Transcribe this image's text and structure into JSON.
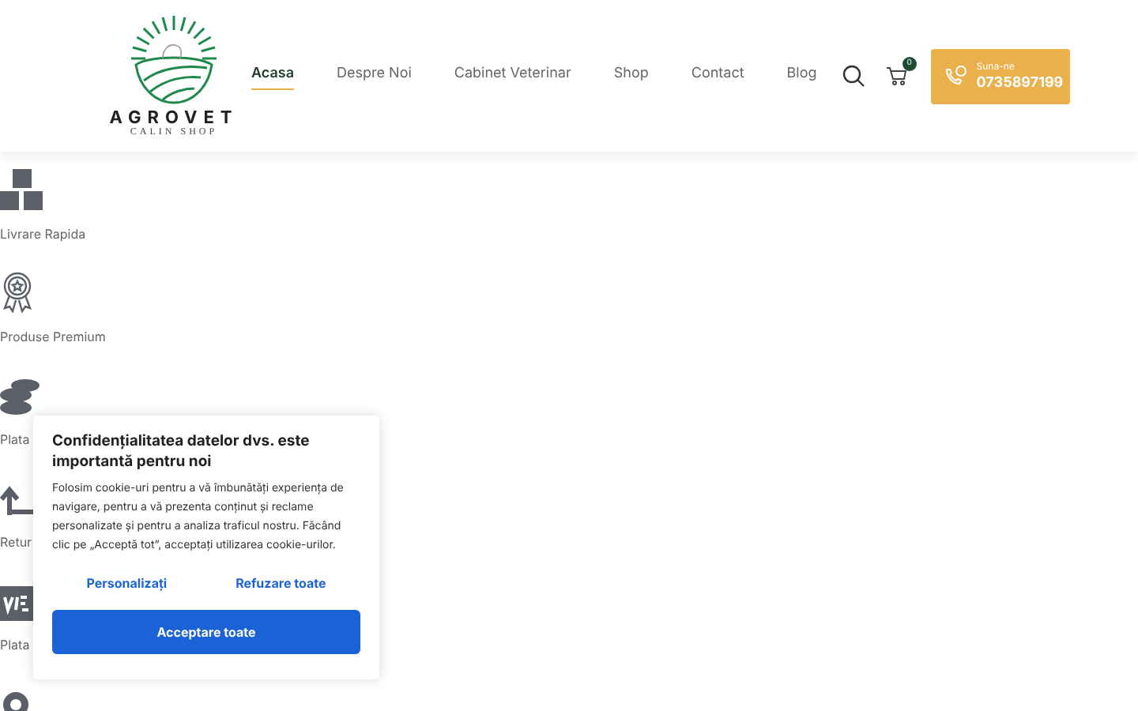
{
  "logo": {
    "name": "AGROVET",
    "subtitle": "CALIN SHOP"
  },
  "nav": [
    {
      "label": "Acasa",
      "selected": true
    },
    {
      "label": "Despre Noi",
      "selected": false
    },
    {
      "label": "Cabinet Veterinar",
      "selected": false
    },
    {
      "label": "Shop",
      "selected": false
    },
    {
      "label": "Contact",
      "selected": false
    },
    {
      "label": "Blog",
      "selected": false
    }
  ],
  "cart": {
    "count": "0"
  },
  "call": {
    "label": "Suna-ne",
    "phone": "0735897199"
  },
  "features": [
    {
      "kind": "boxes",
      "label": "Livrare Rapida"
    },
    {
      "kind": "award",
      "label": "Produse Premium"
    },
    {
      "kind": "coins",
      "label": "Plata"
    },
    {
      "kind": "return",
      "label": "Retur"
    },
    {
      "kind": "card",
      "label": "Plata"
    },
    {
      "kind": "pin"
    }
  ],
  "cookie": {
    "title": "Confidențialitatea datelor dvs. este importantă pentru noi",
    "text": "Folosim cookie-uri pentru a vă îmbunătăți experiența de navigare, pentru a vă prezenta conținut și reclame personalizate și pentru a analiza traficul nostru. Făcând clic pe „Acceptă tot”, acceptați utilizarea cookie-urilor.",
    "customize": "Personalizați",
    "reject": "Refuzare toate",
    "accept": "Acceptare toate"
  }
}
